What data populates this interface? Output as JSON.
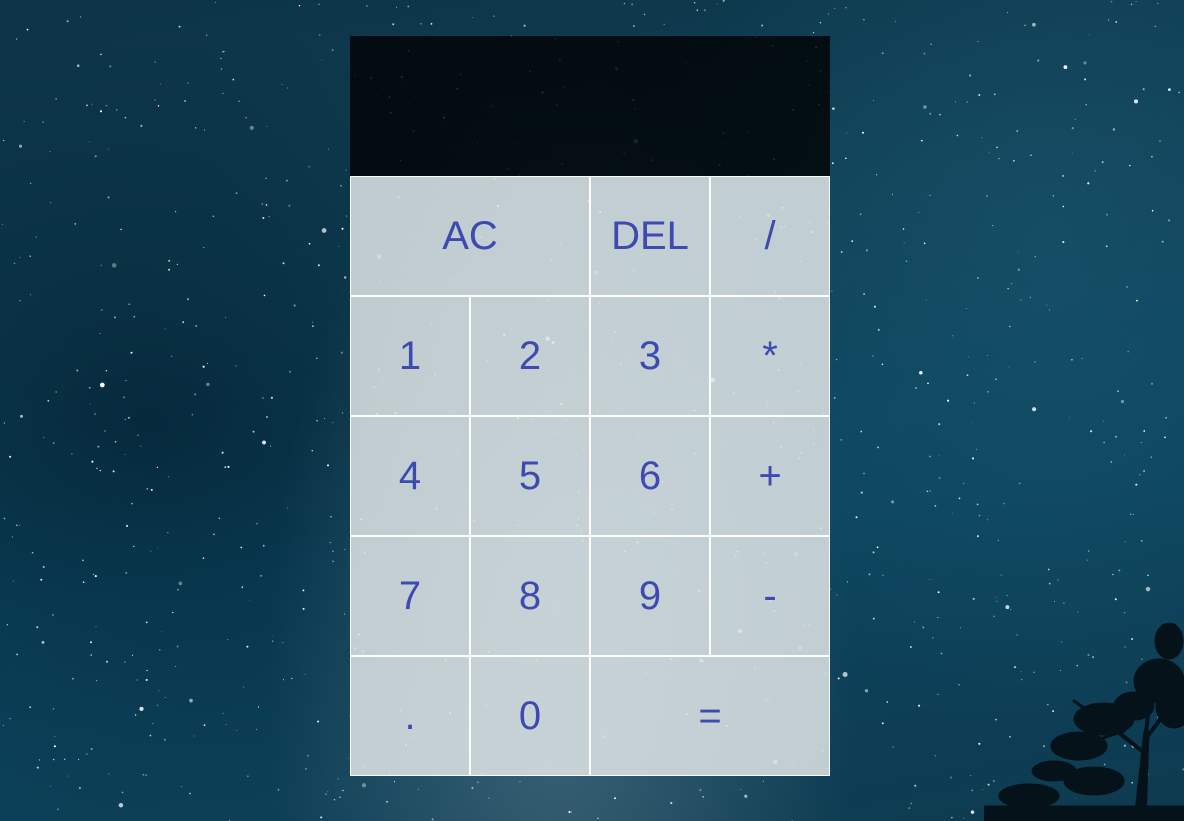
{
  "display": {
    "previous_operand": "",
    "current_operand": ""
  },
  "keys": {
    "all_clear": "AC",
    "delete": "DEL",
    "divide": "/",
    "one": "1",
    "two": "2",
    "three": "3",
    "multiply": "*",
    "four": "4",
    "five": "5",
    "six": "6",
    "add": "+",
    "seven": "7",
    "eight": "8",
    "nine": "9",
    "subtract": "-",
    "decimal": ".",
    "zero": "0",
    "equals": "="
  },
  "colors": {
    "key_text": "#3d4bb0",
    "key_background": "#e1e6e8",
    "display_background": "#000000",
    "page_background": "#0e4158"
  }
}
